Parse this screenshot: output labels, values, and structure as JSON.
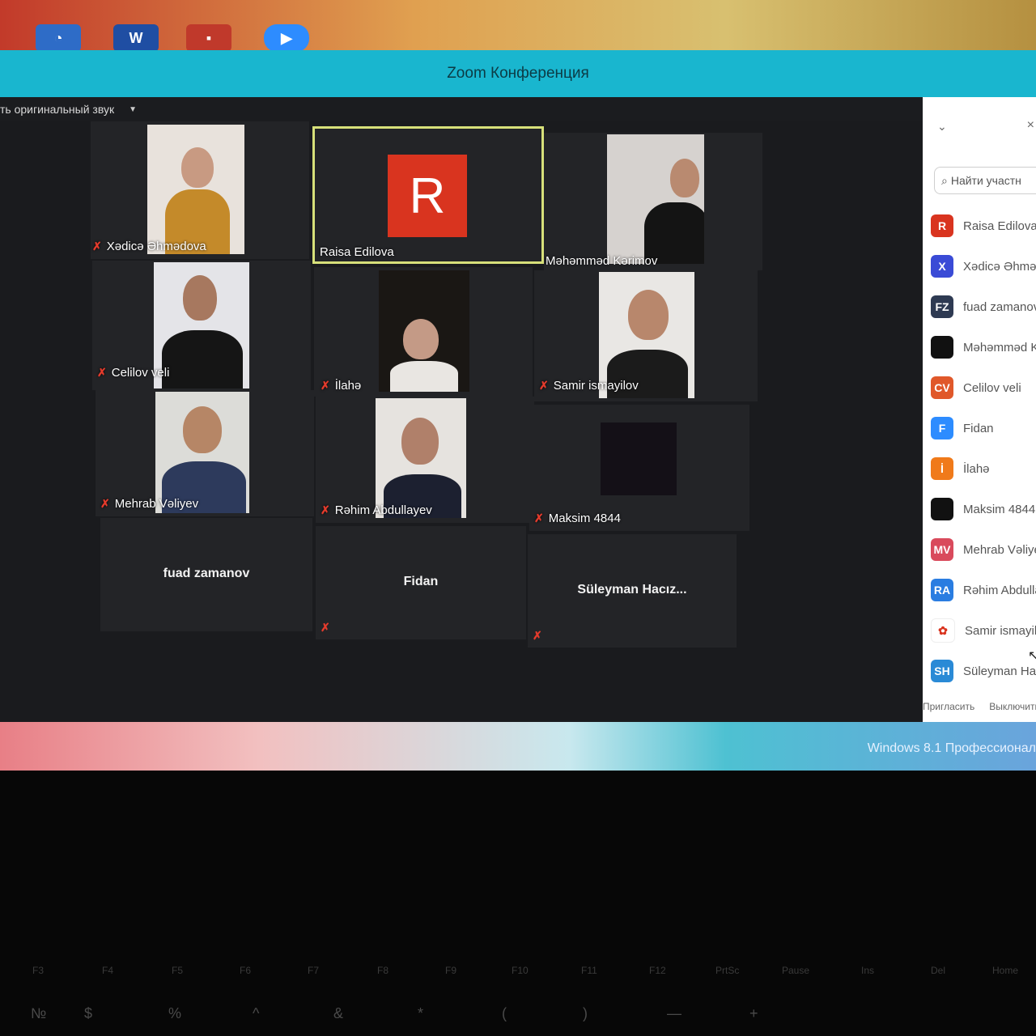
{
  "taskbar_top": {
    "apps": [
      {
        "name": "Outlook",
        "glyph": "◔",
        "color": "#2e6cc7"
      },
      {
        "name": "Word",
        "glyph": "W",
        "color": "#1f4ea3"
      },
      {
        "name": "Photos",
        "glyph": "▪",
        "color": "#c0392b"
      },
      {
        "name": "Zoom",
        "glyph": "▶",
        "color": "#2d8cff"
      }
    ]
  },
  "window": {
    "title": "Zoom Конференция",
    "audio_option": "ть оригинальный звук"
  },
  "gallery": {
    "tiles": [
      {
        "id": "xedica",
        "name": "Xədicə Əhmədova",
        "muted": true,
        "type": "video"
      },
      {
        "id": "raisa",
        "name": "Raisa Edilova",
        "muted": false,
        "type": "avatar",
        "initial": "R",
        "active": true
      },
      {
        "id": "mehemmed",
        "name": "Məhəmməd Kərimov",
        "muted": false,
        "type": "video"
      },
      {
        "id": "celilov",
        "name": "Celilov veli",
        "muted": true,
        "type": "video"
      },
      {
        "id": "ilahe",
        "name": "İlahə",
        "muted": true,
        "type": "video"
      },
      {
        "id": "samir",
        "name": "Samir ismayilov",
        "muted": true,
        "type": "video"
      },
      {
        "id": "mehrab",
        "name": "Mehrab Vəliyev",
        "muted": true,
        "type": "video"
      },
      {
        "id": "rehim",
        "name": "Rəhim Abdullayev",
        "muted": true,
        "type": "video"
      },
      {
        "id": "maksim",
        "name": "Maksim 4844",
        "muted": true,
        "type": "video"
      },
      {
        "id": "fuad",
        "name": "fuad zamanov",
        "muted": false,
        "type": "name"
      },
      {
        "id": "fidan",
        "name": "Fidan",
        "muted": true,
        "type": "name"
      },
      {
        "id": "suleyman",
        "name": "Süleyman  Hacız...",
        "muted": true,
        "type": "name"
      }
    ]
  },
  "panel": {
    "search_placeholder": "Найти участн",
    "participants": [
      {
        "initials": "R",
        "name": "Raisa Edilova",
        "color": "#d9341f"
      },
      {
        "initials": "X",
        "name": "Xədicə Əhmədova",
        "color": "#3a4bd6"
      },
      {
        "initials": "FZ",
        "name": "fuad zamanov",
        "color": "#2e3a52"
      },
      {
        "initials": "",
        "name": "Məhəmməd Kərimov",
        "color": "#111111"
      },
      {
        "initials": "CV",
        "name": "Celilov veli",
        "color": "#e0582a"
      },
      {
        "initials": "F",
        "name": "Fidan",
        "color": "#2d8cff"
      },
      {
        "initials": "İ",
        "name": "İlahə",
        "color": "#f07a1a"
      },
      {
        "initials": "",
        "name": "Maksim 4844",
        "color": "#111111"
      },
      {
        "initials": "MV",
        "name": "Mehrab Vəliyev",
        "color": "#d94a5c"
      },
      {
        "initials": "RA",
        "name": "Rəhim Abdullayev",
        "color": "#2a7de1"
      },
      {
        "initials": "✿",
        "name": "Samir ismayilov",
        "color": "#d9341f"
      },
      {
        "initials": "SH",
        "name": "Süleyman Hacızadə",
        "color": "#2a8ad6"
      }
    ],
    "invite_label": "Пригласить",
    "mute_label": "Выключить мой"
  },
  "taskbar_bottom": {
    "os_label": "Windows 8.1 Профессионал"
  },
  "keyboard": {
    "fkeys": [
      "F3",
      "F4",
      "F5",
      "F6",
      "F7",
      "F8",
      "F9",
      "F10",
      "F11",
      "F12",
      "PrtSc",
      "Pause",
      "Ins",
      "Del",
      "Home"
    ],
    "numkeys": [
      "№",
      "$",
      "%",
      "^",
      "&",
      "*",
      "(",
      ")",
      "—",
      "+"
    ]
  }
}
